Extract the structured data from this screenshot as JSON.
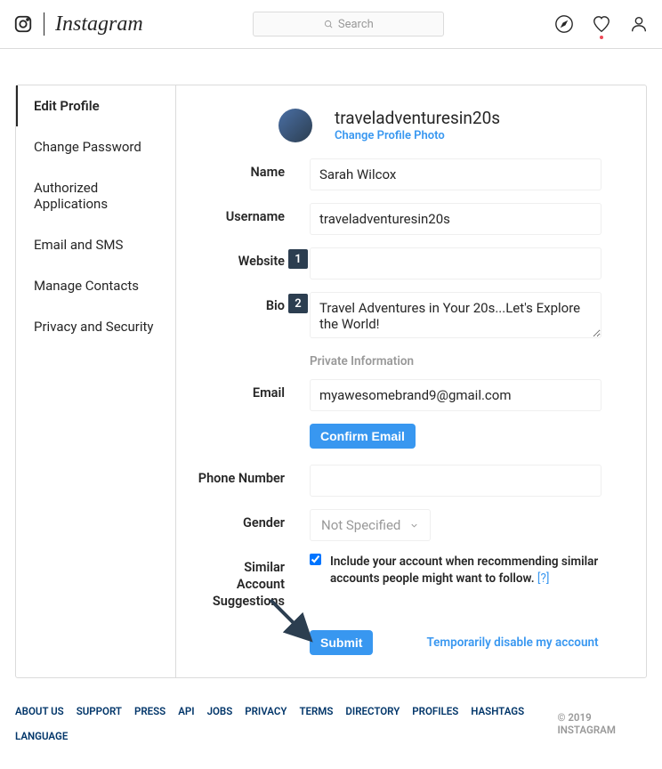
{
  "header": {
    "search_placeholder": "Search"
  },
  "sidebar": {
    "items": [
      {
        "label": "Edit Profile",
        "active": true
      },
      {
        "label": "Change Password",
        "active": false
      },
      {
        "label": "Authorized Applications",
        "active": false
      },
      {
        "label": "Email and SMS",
        "active": false
      },
      {
        "label": "Manage Contacts",
        "active": false
      },
      {
        "label": "Privacy and Security",
        "active": false
      }
    ]
  },
  "profile": {
    "username_display": "traveladventuresin20s",
    "change_photo": "Change Profile Photo"
  },
  "form": {
    "name": {
      "label": "Name",
      "value": "Sarah Wilcox"
    },
    "username": {
      "label": "Username",
      "value": "traveladventuresin20s"
    },
    "website": {
      "label": "Website",
      "value": ""
    },
    "bio": {
      "label": "Bio",
      "value": "Travel Adventures in Your 20s...Let's Explore the World!"
    },
    "private_heading": "Private Information",
    "email": {
      "label": "Email",
      "value": "myawesomebrand9@gmail.com"
    },
    "confirm_email": "Confirm Email",
    "phone": {
      "label": "Phone Number",
      "value": ""
    },
    "gender": {
      "label": "Gender",
      "value": "Not Specified"
    },
    "suggestions": {
      "label": "Similar Account Suggestions",
      "checkbox_label": "Include your account when recommending similar accounts people might want to follow.",
      "help": "[?]"
    },
    "submit": "Submit",
    "disable": "Temporarily disable my account"
  },
  "footer": {
    "links": [
      "ABOUT US",
      "SUPPORT",
      "PRESS",
      "API",
      "JOBS",
      "PRIVACY",
      "TERMS",
      "DIRECTORY",
      "PROFILES",
      "HASHTAGS",
      "LANGUAGE"
    ],
    "copyright": "© 2019 INSTAGRAM"
  },
  "annotations": {
    "badge1": "1",
    "badge2": "2"
  }
}
